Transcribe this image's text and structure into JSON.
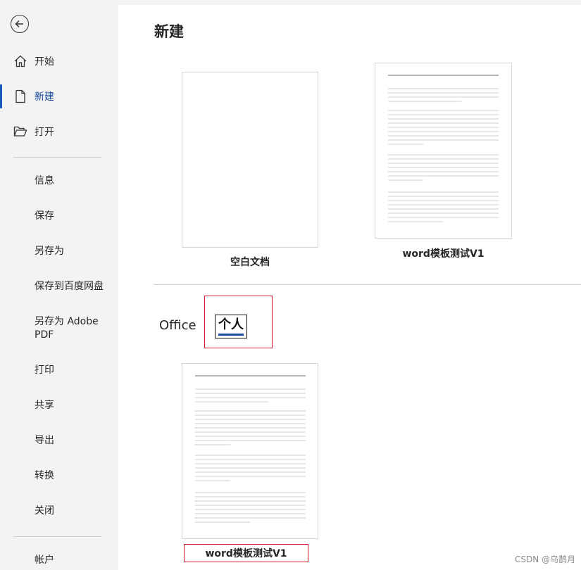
{
  "sidebar": {
    "back_label": "",
    "items": [
      {
        "label": "开始",
        "icon": "home-icon"
      },
      {
        "label": "新建",
        "icon": "new-document-icon"
      },
      {
        "label": "打开",
        "icon": "open-folder-icon"
      }
    ],
    "sub_items": [
      "信息",
      "保存",
      "另存为",
      "保存到百度网盘",
      "另存为 Adobe PDF",
      "打印",
      "共享",
      "导出",
      "转换",
      "关闭"
    ],
    "bottom_item": "帐户"
  },
  "main": {
    "title": "新建",
    "templates_top": [
      {
        "label": "空白文档"
      },
      {
        "label": "word模板测试V1"
      }
    ],
    "tabs": [
      {
        "label": "Office"
      },
      {
        "label": "个人"
      }
    ],
    "templates_personal": [
      {
        "label": "word模板测试V1"
      }
    ]
  },
  "watermark": "CSDN @乌鹊月",
  "colors": {
    "accent": "#1b4aa0",
    "highlight_box": "#d9182b"
  }
}
